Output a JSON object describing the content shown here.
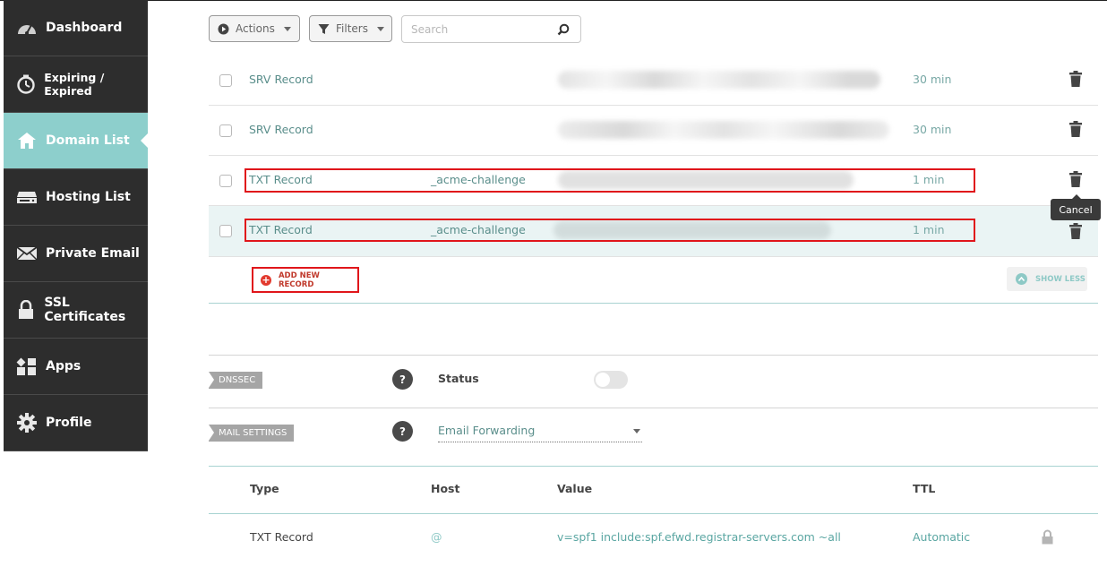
{
  "sidebar": {
    "items": [
      {
        "label": "Dashboard",
        "icon": "speedometer-icon"
      },
      {
        "label": "Expiring / Expired",
        "icon": "timer-icon"
      },
      {
        "label": "Domain List",
        "icon": "home-icon"
      },
      {
        "label": "Hosting List",
        "icon": "server-icon"
      },
      {
        "label": "Private Email",
        "icon": "envelope-icon"
      },
      {
        "label": "SSL Certificates",
        "icon": "lock-icon"
      },
      {
        "label": "Apps",
        "icon": "apps-icon"
      },
      {
        "label": "Profile",
        "icon": "gear-icon"
      }
    ],
    "active_index": 2
  },
  "toolbar": {
    "actions_label": "Actions",
    "filters_label": "Filters",
    "search_placeholder": "Search"
  },
  "records": [
    {
      "type": "SRV Record",
      "host": "",
      "ttl": "30 min"
    },
    {
      "type": "SRV Record",
      "host": "",
      "ttl": "30 min"
    },
    {
      "type": "TXT Record",
      "host": "_acme-challenge",
      "ttl": "1 min"
    },
    {
      "type": "TXT Record",
      "host": "_acme-challenge",
      "ttl": "1 min"
    }
  ],
  "tooltip": "Cancel",
  "add_record_label": "ADD NEW RECORD",
  "show_less_label": "SHOW LESS",
  "dnssec": {
    "tag": "DNSSEC",
    "status_label": "Status",
    "enabled": false
  },
  "mail": {
    "tag": "MAIL SETTINGS",
    "selected": "Email Forwarding"
  },
  "mail_table": {
    "headers": [
      "Type",
      "Host",
      "Value",
      "TTL"
    ],
    "row": {
      "type": "TXT Record",
      "host": "@",
      "value": "v=spf1 include:spf.efwd.registrar-servers.com ~all",
      "ttl": "Automatic"
    }
  },
  "colors": {
    "accent": "#8dcfcc",
    "highlight": "#e0161b",
    "sidebar": "#2d2d2d"
  }
}
